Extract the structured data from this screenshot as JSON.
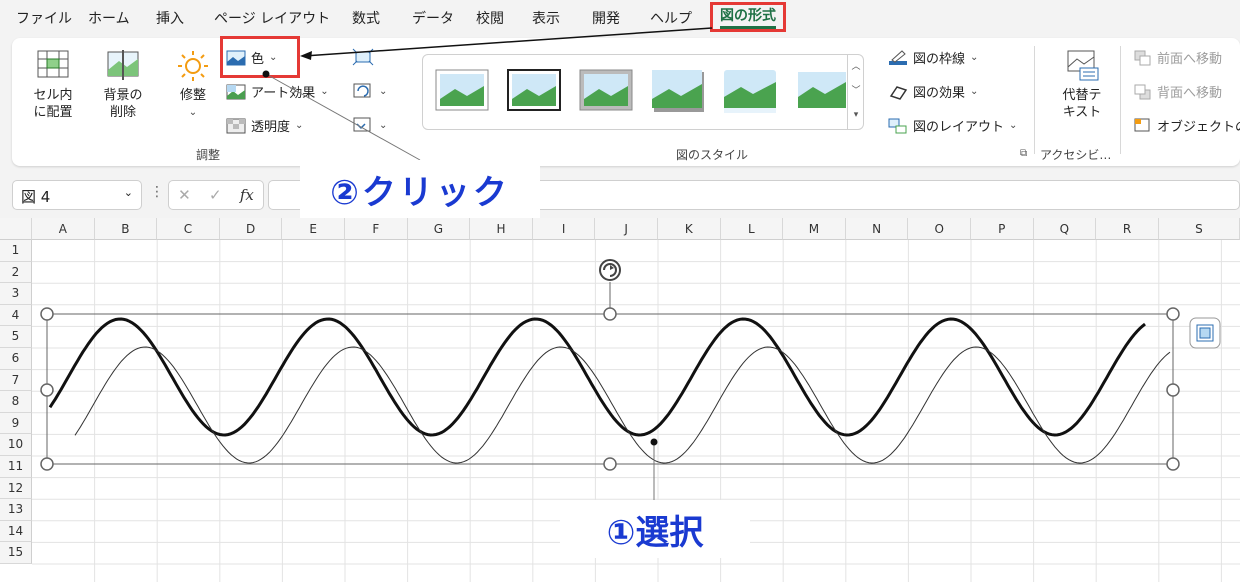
{
  "menu": {
    "tabs": [
      "ファイル",
      "ホーム",
      "挿入",
      "ページ レイアウト",
      "数式",
      "データ",
      "校閲",
      "表示",
      "開発",
      "ヘルプ"
    ],
    "active_tab": "図の形式"
  },
  "ribbon": {
    "adjust": {
      "cell_place": "セル内\nに配置",
      "remove_bg": "背景の\n削除",
      "corrections": "修整",
      "color": "色",
      "art_effects": "アート効果",
      "transparency": "透明度",
      "group_label": "調整"
    },
    "styles": {
      "group_label": "図のスタイル",
      "border": "図の枠線",
      "effects": "図の効果",
      "layout": "図のレイアウト"
    },
    "accessibility": {
      "alt_text": "代替テ\nキスト",
      "group_label": "アクセシビ…"
    },
    "arrange": {
      "bring_forward": "前面へ移動",
      "send_backward": "背面へ移動",
      "selection_pane": "オブジェクトの"
    }
  },
  "formula_bar": {
    "name_box": "図 4",
    "cancel": "✕",
    "enter": "✓",
    "fx": "fx"
  },
  "annotations": {
    "click": "②クリック",
    "select": "①選択"
  },
  "sheet": {
    "columns": [
      "A",
      "B",
      "C",
      "D",
      "E",
      "F",
      "G",
      "H",
      "I",
      "J",
      "K",
      "L",
      "M",
      "N",
      "O",
      "P",
      "Q",
      "R",
      "S"
    ],
    "rows": [
      "1",
      "2",
      "3",
      "4",
      "5",
      "6",
      "7",
      "8",
      "9",
      "10",
      "11",
      "12",
      "13",
      "14",
      "15"
    ]
  },
  "colors": {
    "accent_green": "#1e7145",
    "highlight_red": "#e53935",
    "annotation_blue": "#1a3ad1"
  }
}
